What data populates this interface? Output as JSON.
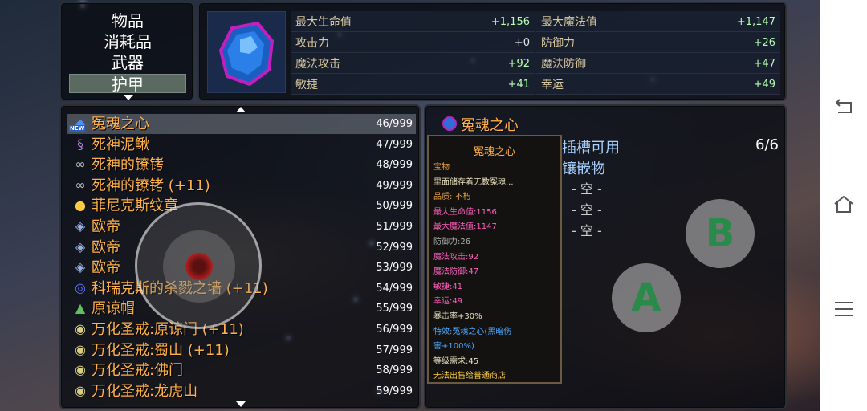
{
  "categories": {
    "items": [
      "物品",
      "消耗品",
      "武器",
      "护甲"
    ],
    "selected_index": 3
  },
  "stats": {
    "left": [
      {
        "label": "最大生命值",
        "value": "+1,156"
      },
      {
        "label": "攻击力",
        "value": "+0"
      },
      {
        "label": "魔法攻击",
        "value": "+92"
      },
      {
        "label": "敏捷",
        "value": "+41"
      }
    ],
    "right": [
      {
        "label": "最大魔法值",
        "value": "+1,147"
      },
      {
        "label": "防御力",
        "value": "+26"
      },
      {
        "label": "魔法防御",
        "value": "+47"
      },
      {
        "label": "幸运",
        "value": "+49"
      }
    ]
  },
  "items": [
    {
      "name": "冤魂之心",
      "qty": "46/999",
      "icon": "blue-gem-icon",
      "badge": "NEW"
    },
    {
      "name": "死神泥鳅",
      "qty": "47/999",
      "icon": "eel-icon"
    },
    {
      "name": "死神的镣铐",
      "qty": "48/999",
      "icon": "shackle-icon"
    },
    {
      "name": "死神的镣铐 (+11)",
      "qty": "49/999",
      "icon": "shackle-icon"
    },
    {
      "name": "菲尼克斯纹章",
      "qty": "50/999",
      "icon": "emblem-icon"
    },
    {
      "name": "欧帝",
      "qty": "51/999",
      "icon": "armor-icon"
    },
    {
      "name": "欧帝",
      "qty": "52/999",
      "icon": "armor-icon"
    },
    {
      "name": "欧帝",
      "qty": "53/999",
      "icon": "armor-icon"
    },
    {
      "name": "科瑞克斯的杀戮之墙 (+11)",
      "qty": "54/999",
      "icon": "ring-icon"
    },
    {
      "name": "原谅帽",
      "qty": "55/999",
      "icon": "hat-icon"
    },
    {
      "name": "万化圣戒:原谅门 (+11)",
      "qty": "56/999",
      "icon": "holy-ring-icon"
    },
    {
      "name": "万化圣戒:蜀山 (+11)",
      "qty": "57/999",
      "icon": "holy-ring-icon"
    },
    {
      "name": "万化圣戒:佛门",
      "qty": "58/999",
      "icon": "holy-ring-icon"
    },
    {
      "name": "万化圣戒:龙虎山",
      "qty": "59/999",
      "icon": "holy-ring-icon"
    }
  ],
  "selected_item_index": 0,
  "detail": {
    "title": "冤魂之心",
    "tooltip": {
      "title": "冤魂之心",
      "lines": [
        {
          "text": "宝物",
          "color": "#e8a040"
        },
        {
          "text": "里面储存着无数冤魂...",
          "color": "#e8e0c0"
        },
        {
          "text": "品质: 不朽",
          "color": "#e8a040"
        },
        {
          "text": "最大生命值:1156",
          "color": "#ff60c0"
        },
        {
          "text": "最大魔法值:1147",
          "color": "#ff60c0"
        },
        {
          "text": "防御力:26",
          "color": "#b0b0b0"
        },
        {
          "text": "魔法攻击:92",
          "color": "#ff60c0"
        },
        {
          "text": "魔法防御:47",
          "color": "#ff60c0"
        },
        {
          "text": "敏捷:41",
          "color": "#ff60c0"
        },
        {
          "text": "幸运:49",
          "color": "#ff60c0"
        },
        {
          "text": "暴击率+30%",
          "color": "#e8e0c0"
        },
        {
          "text": "特效:冤魂之心(黑暗伤",
          "color": "#4aa8ff"
        },
        {
          "text": "害+100%)",
          "color": "#4aa8ff"
        },
        {
          "text": "等级需求:45",
          "color": "#e8e0c0"
        },
        {
          "text": "无法出售给普通商店",
          "color": "#ffd040"
        }
      ]
    },
    "slot_label_1": "插槽可用",
    "slot_label_2": "镶嵌物",
    "slot_count": "6/6",
    "slots": [
      "- 空 -",
      "- 空 -",
      "- 空 -"
    ]
  },
  "controls": {
    "button_a": "A",
    "button_b": "B"
  },
  "colors": {
    "item_name": "#ffb04a",
    "stat_value": "#b8ffb0",
    "slot_header": "#a8d0ff"
  }
}
